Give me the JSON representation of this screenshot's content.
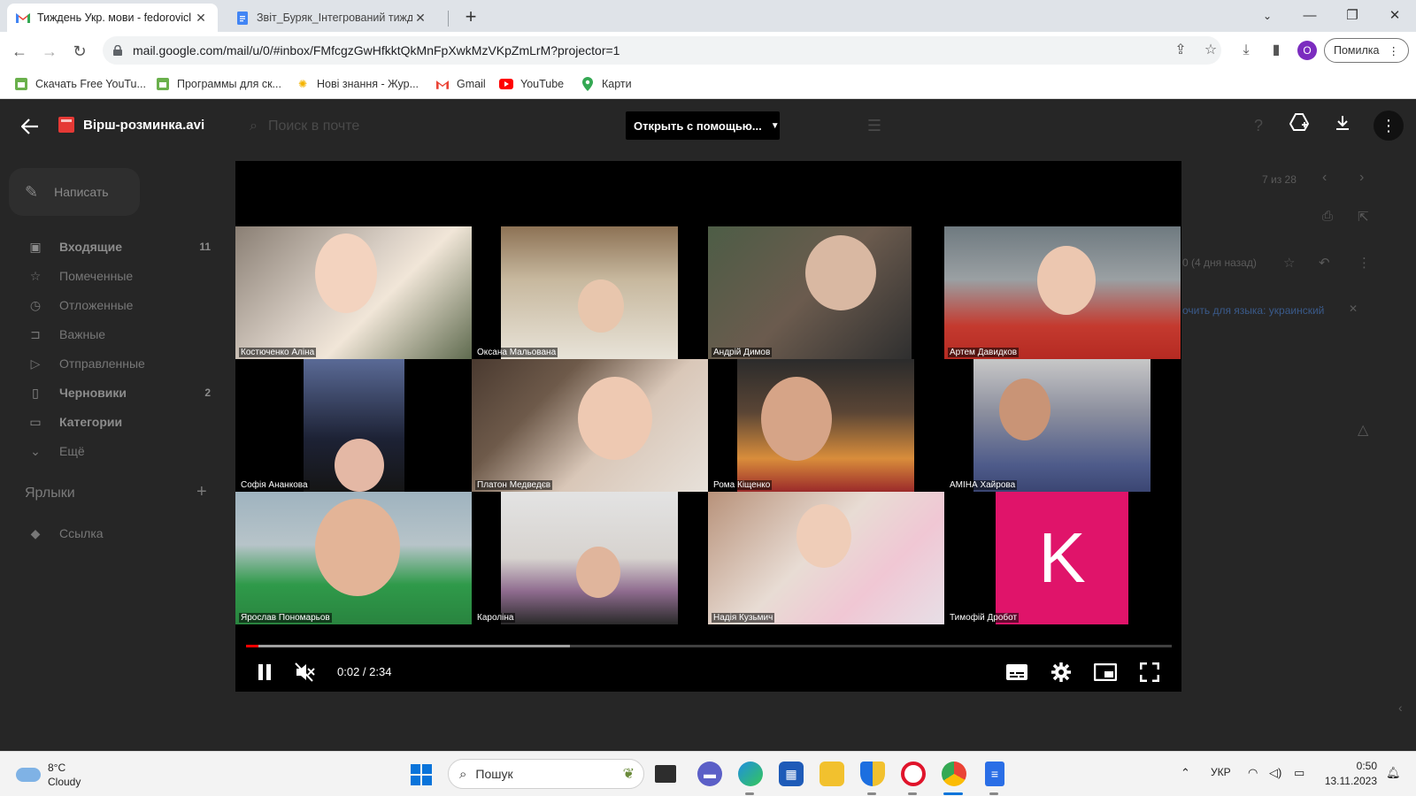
{
  "browser": {
    "tabs": [
      {
        "title": "Тиждень Укр. мови - fedorovicl",
        "active": true,
        "icon": "gmail-icon"
      },
      {
        "title": "Звіт_Буряк_Інтегрований тижд",
        "active": false,
        "icon": "docs-icon"
      }
    ],
    "url": "mail.google.com/mail/u/0/#inbox/FMfcgzGwHfkktQkMnFpXwkMzVKpZmLrM?projector=1",
    "profile_initial": "O",
    "error_label": "Помилка",
    "bookmarks": [
      {
        "label": "Скачать Free YouTu...",
        "icon": "app-icon"
      },
      {
        "label": "Программы для ск...",
        "icon": "app-icon"
      },
      {
        "label": "Нові знання - Жур...",
        "icon": "sun-icon"
      },
      {
        "label": "Gmail",
        "icon": "gmail-icon"
      },
      {
        "label": "YouTube",
        "icon": "youtube-icon"
      },
      {
        "label": "Карти",
        "icon": "maps-pin-icon"
      }
    ]
  },
  "gmail": {
    "compose_label": "Написать",
    "search_placeholder": "Поиск в почте",
    "nav": [
      {
        "label": "Входящие",
        "count": "11",
        "bold": true,
        "icon": "inbox-icon"
      },
      {
        "label": "Помеченные",
        "count": "",
        "bold": false,
        "icon": "star-icon"
      },
      {
        "label": "Отложенные",
        "count": "",
        "bold": false,
        "icon": "clock-icon"
      },
      {
        "label": "Важные",
        "count": "",
        "bold": false,
        "icon": "important-icon"
      },
      {
        "label": "Отправленные",
        "count": "",
        "bold": false,
        "icon": "send-icon"
      },
      {
        "label": "Черновики",
        "count": "2",
        "bold": true,
        "icon": "draft-icon"
      },
      {
        "label": "Категории",
        "count": "",
        "bold": true,
        "icon": "label-icon"
      },
      {
        "label": "Ещё",
        "count": "",
        "bold": false,
        "icon": "chevron-down-icon"
      }
    ],
    "labels_heading": "Ярлыки",
    "labels": [
      {
        "label": "Ссылка"
      }
    ],
    "pager": "7 из 28",
    "date_fragment": "0 (4 дня назад)",
    "translate_fragment": "очить для языка: украинский"
  },
  "viewer": {
    "file_name": "Вірш-розминка.avi",
    "open_with_label": "Открыть с помощью...",
    "participants": [
      "Костюченко Аліна",
      "Оксана Мальована",
      "Андрій Димов",
      "Артем Давидков",
      "Софія Ананкова",
      "Платон Медведєв",
      "Рома Кіщенко",
      "АМІНА Хайрова",
      "Ярослав Пономарьов",
      "Кароліна",
      "Надія Кузьмич",
      "Тимофій Дробот"
    ],
    "avatar_letter": "K",
    "avatar_color": "#e0146a",
    "time_current": "0:02",
    "time_total": "2:34",
    "time_display": "0:02 / 2:34",
    "progress_played": 0.013,
    "progress_buffered": 0.35
  },
  "taskbar": {
    "weather_temp": "8°C",
    "weather_desc": "Cloudy",
    "search_label": "Пошук",
    "language": "УКР",
    "time": "0:50",
    "date": "13.11.2023"
  },
  "colors": {
    "player_progress": "#ff0000",
    "start_blue": "#0a74da"
  }
}
